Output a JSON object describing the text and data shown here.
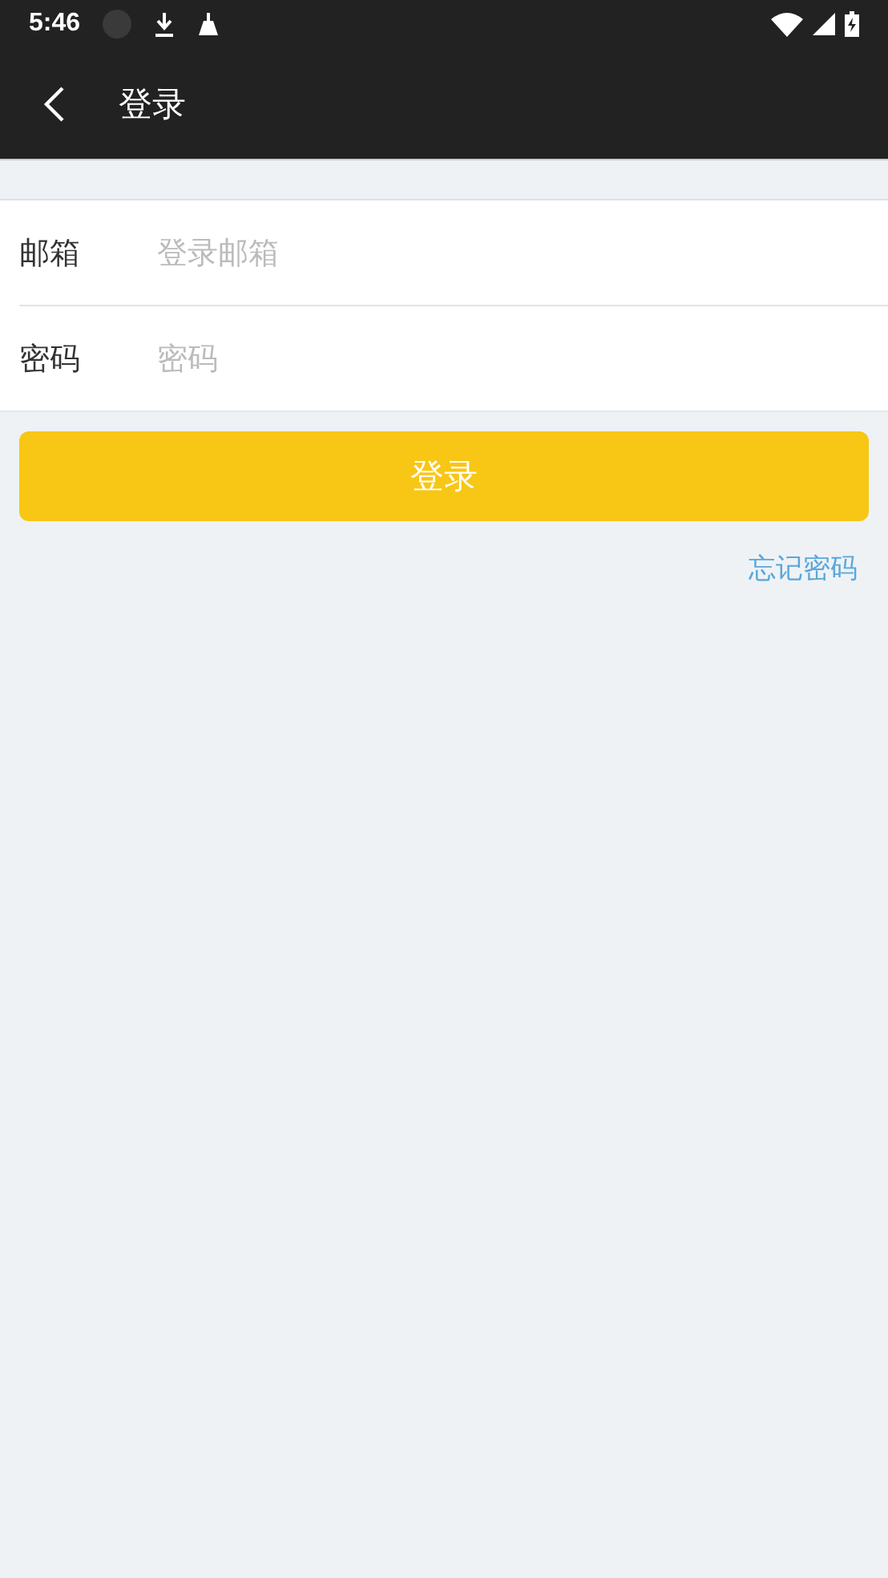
{
  "status_bar": {
    "time": "5:46"
  },
  "app_bar": {
    "title": "登录"
  },
  "form": {
    "fields": [
      {
        "label": "邮箱",
        "placeholder": "登录邮箱"
      },
      {
        "label": "密码",
        "placeholder": "密码"
      }
    ]
  },
  "login_button": "登录",
  "forgot_password_link": "忘记密码"
}
